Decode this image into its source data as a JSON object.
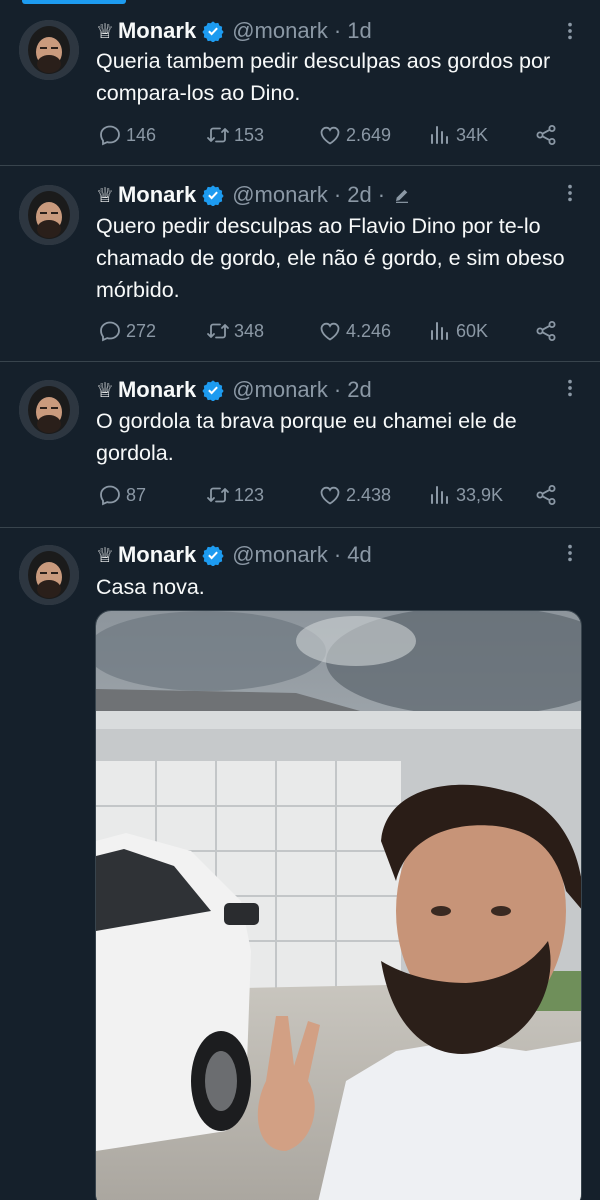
{
  "account": {
    "crown": "♕",
    "name": "Monark",
    "handle": "@monark",
    "separator": "·"
  },
  "tweets": [
    {
      "time": "1d",
      "text": "Queria tambem pedir desculpas aos gordos por compara-los ao Dino.",
      "replies": "146",
      "retweets": "153",
      "likes": "2.649",
      "views": "34K",
      "edited": false
    },
    {
      "time": "2d",
      "text": "Quero pedir desculpas ao Flavio Dino por te-lo chamado de gordo, ele não é gordo, e sim obeso mórbido.",
      "replies": "272",
      "retweets": "348",
      "likes": "4.246",
      "views": "60K",
      "edited": true
    },
    {
      "time": "2d",
      "text": "O gordola ta brava porque eu chamei ele de gordola.",
      "replies": "87",
      "retweets": "123",
      "likes": "2.438",
      "views": "33,9K",
      "edited": false
    },
    {
      "time": "4d",
      "text": "Casa nova.",
      "has_photo": true
    }
  ],
  "icons": {
    "verified": "verified-badge-icon",
    "more": "more-options-icon",
    "reply": "reply-icon",
    "retweet": "retweet-icon",
    "like": "heart-icon",
    "views": "views-icon",
    "share": "share-icon",
    "edit": "edited-pencil-icon"
  },
  "colors": {
    "background": "#15202b",
    "accent": "#1d9bf0",
    "text": "#f7f9f9",
    "muted": "#8b98a5",
    "divider": "#38444d"
  }
}
